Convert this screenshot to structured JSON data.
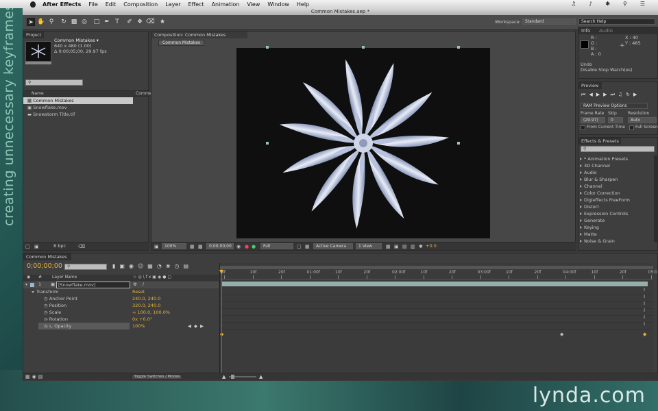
{
  "menubar": {
    "app": "After Effects",
    "items": [
      "File",
      "Edit",
      "Composition",
      "Layer",
      "Effect",
      "Animation",
      "View",
      "Window",
      "Help"
    ]
  },
  "window": {
    "title": "Common Mistakes.aep *"
  },
  "workspace": {
    "label": "Workspace:",
    "value": "Standard",
    "search_placeholder": "Search Help"
  },
  "project": {
    "tab": "Project",
    "comp_name": "Common Mistakes ▾",
    "comp_size": "640 x 480 (1.00)",
    "comp_duration": "Δ 0;00;05;00, 29.97 fps",
    "col_name": "Name",
    "col_comment": "Comme",
    "items": [
      "Common Mistakes",
      "Snowflake.mov",
      "Snowstorm Title.tif"
    ],
    "bpc": "8 bpc"
  },
  "composition": {
    "tab": "Composition: Common Mistakes",
    "breadcrumb": "Common Mistakes",
    "zoom": "100%",
    "timecode": "0;00;00;00",
    "resolution": "Full",
    "camera": "Active Camera",
    "views": "1 View",
    "exposure": "+0.0"
  },
  "info": {
    "tab": "Info",
    "tab2": "Audio",
    "r": "R :",
    "g": "G :",
    "b": "B :",
    "a": "A : 0",
    "x": "X : 40",
    "y": "Y : 485",
    "undo": "Undo",
    "undo_action": "Disable Stop Watch(es)"
  },
  "preview": {
    "tab": "Preview",
    "options": "RAM Preview Options",
    "frame_rate_label": "Frame Rate",
    "skip_label": "Skip",
    "resolution_label": "Resolution",
    "frame_rate": "(29.97)",
    "skip": "0",
    "resolution": "Auto",
    "from_current": "From Current Time",
    "full_screen": "Full Screen"
  },
  "effects": {
    "tab": "Effects & Presets",
    "items": [
      "* Animation Presets",
      "3D Channel",
      "Audio",
      "Blur & Sharpen",
      "Channel",
      "Color Correction",
      "Digieffects FreeForm",
      "Distort",
      "Expression Controls",
      "Generate",
      "Keying",
      "Matte",
      "Noise & Grain"
    ]
  },
  "timeline": {
    "tab": "Common Mistakes",
    "timecode": "0;00;00;00",
    "col_num": "#",
    "col_layer": "Layer Name",
    "layer_num": "1",
    "layer_name": "[Snowflake.mov]",
    "transform": "Transform",
    "reset": "Reset",
    "props": [
      {
        "name": "Anchor Point",
        "value": "240.0, 240.0"
      },
      {
        "name": "Position",
        "value": "320.0, 240.0"
      },
      {
        "name": "Scale",
        "value": "∞ 100.0, 100.0%"
      },
      {
        "name": "Rotation",
        "value": "0x +0.0°"
      },
      {
        "name": "Opacity",
        "value": "100%"
      }
    ],
    "ruler": [
      "0f",
      "10f",
      "20f",
      "01:00f",
      "10f",
      "20f",
      "02:00f",
      "10f",
      "20f",
      "03:00f",
      "10f",
      "20f",
      "04:00f",
      "10f",
      "20f",
      "05:0"
    ],
    "toggle": "Toggle Switches / Modes"
  },
  "overlay": {
    "caption": "creating unnecessary keyframes",
    "logo": "lynda.com"
  },
  "colors": {
    "accent": "#e8b33a",
    "workarea": "#a8c4c0"
  }
}
